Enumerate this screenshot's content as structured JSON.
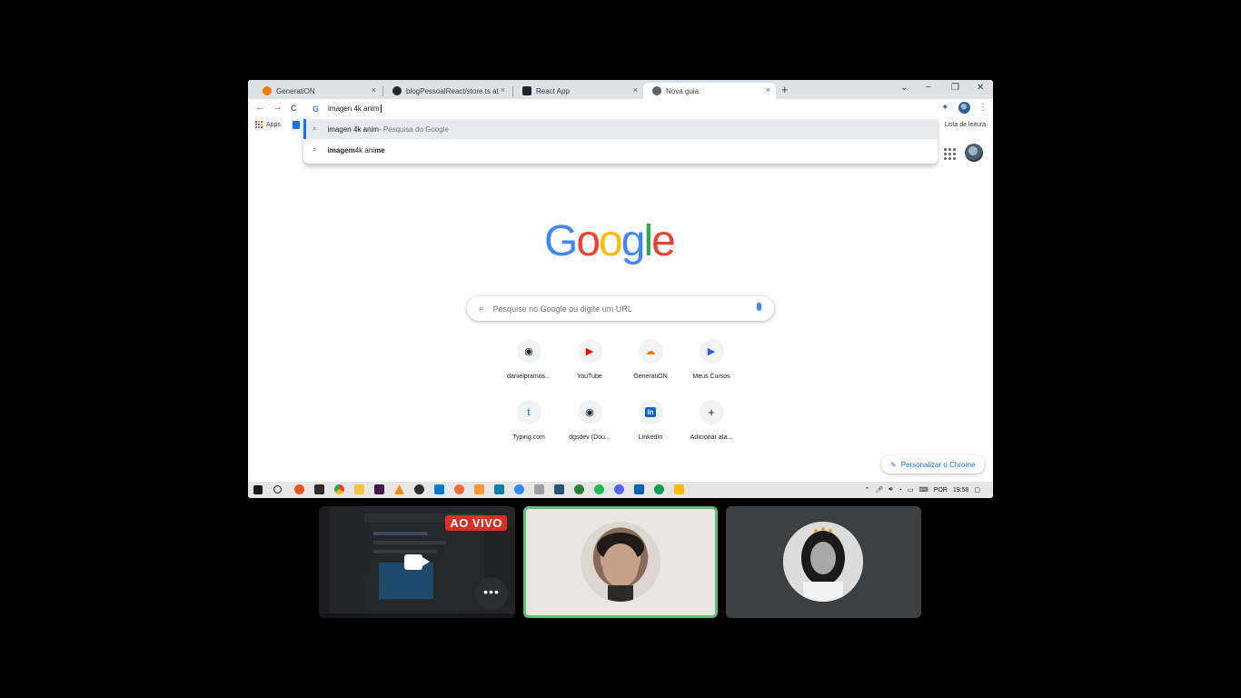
{
  "browser": {
    "tabs": [
      {
        "title": "GeneratiON",
        "favicon_color": "#f57c00"
      },
      {
        "title": "blogPessoalReact/store.ts at 18-...",
        "favicon_color": "#24292e"
      },
      {
        "title": "React App",
        "favicon_color": "#20232a"
      },
      {
        "title": "Nova guia",
        "favicon_color": "#5f6368"
      }
    ],
    "tab_close": "×",
    "new_tab": "+",
    "window_controls": {
      "dropdown": "⌄",
      "minimize": "−",
      "restore": "❐",
      "close": "✕"
    },
    "nav": {
      "back": "←",
      "forward": "→",
      "reload": "C"
    },
    "omnibox": {
      "g_icon": "G",
      "value": "imagen 4k anim"
    },
    "bookmarks": {
      "apps_label": "Apps",
      "reading_list": "Lista de leitura"
    },
    "suggestions": [
      {
        "query": "imagen 4k anim",
        "source": " - Pesquisa do Google"
      },
      {
        "bold_start": "imagem",
        "plain": " 4k ani",
        "bold_end": "me"
      }
    ]
  },
  "ntp": {
    "logo_letters": [
      {
        "ch": "G",
        "color": "#4285f4"
      },
      {
        "ch": "o",
        "color": "#ea4335"
      },
      {
        "ch": "o",
        "color": "#fbbc05"
      },
      {
        "ch": "g",
        "color": "#4285f4"
      },
      {
        "ch": "l",
        "color": "#34a853"
      },
      {
        "ch": "e",
        "color": "#ea4335"
      }
    ],
    "search_placeholder": "Pesquise no Google ou digite um URL",
    "shortcuts": [
      {
        "label": "danielpramos...",
        "icon": "github-icon",
        "glyph": "◉",
        "color": "#24292e"
      },
      {
        "label": "YouTube",
        "icon": "youtube-icon",
        "glyph": "▶",
        "color": "#ff0000"
      },
      {
        "label": "GeneratiON",
        "icon": "generation-icon",
        "glyph": "☁",
        "color": "#f57c00"
      },
      {
        "label": "Meus Cursos",
        "icon": "cursos-icon",
        "glyph": "▶",
        "color": "#3b5bdb"
      },
      {
        "label": "Typing.com",
        "icon": "typing-icon",
        "glyph": "t",
        "color": "#2a9fd6"
      },
      {
        "label": "dgsdev (Dou...",
        "icon": "github-icon",
        "glyph": "◉",
        "color": "#24292e"
      },
      {
        "label": "LinkedIn",
        "icon": "linkedin-icon",
        "glyph": "in",
        "color": "#0a66c2"
      },
      {
        "label": "Adicionar ata...",
        "icon": "add-icon",
        "glyph": "+",
        "color": "#202124"
      }
    ],
    "customize_label": "Personalizar o Chrome"
  },
  "taskbar": {
    "language": "POR",
    "time": "19:58"
  },
  "meet": {
    "live_badge": "AO VIVO",
    "more_label": "•••"
  }
}
